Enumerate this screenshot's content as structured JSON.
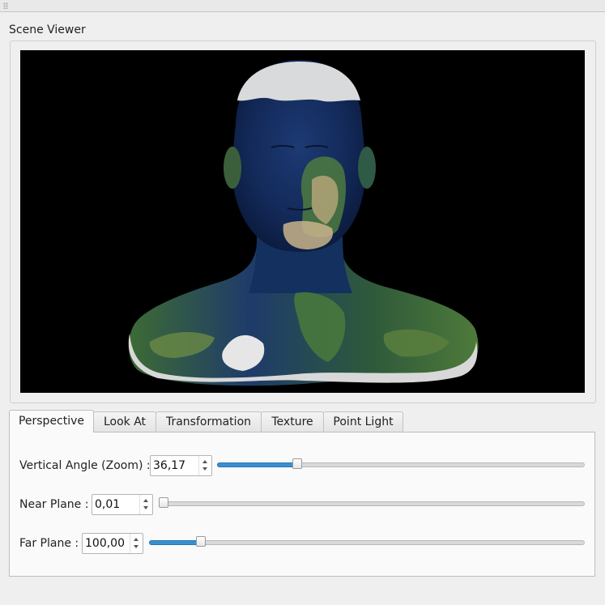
{
  "window": {
    "title": "Scene Viewer"
  },
  "tabs": [
    {
      "label": "Perspective",
      "active": true
    },
    {
      "label": "Look At",
      "active": false
    },
    {
      "label": "Transformation",
      "active": false
    },
    {
      "label": "Texture",
      "active": false
    },
    {
      "label": "Point Light",
      "active": false
    }
  ],
  "perspective": {
    "vertical_angle": {
      "label": "Vertical Angle (Zoom) :",
      "value": "36,17",
      "slider_fraction": 0.21
    },
    "near_plane": {
      "label": "Near Plane :",
      "value": "0,01",
      "slider_fraction": 0.0
    },
    "far_plane": {
      "label": "Far Plane :",
      "value": "100,00",
      "slider_fraction": 0.11
    }
  },
  "colors": {
    "accent": "#3a8fd0",
    "viewport_bg": "#000000"
  }
}
